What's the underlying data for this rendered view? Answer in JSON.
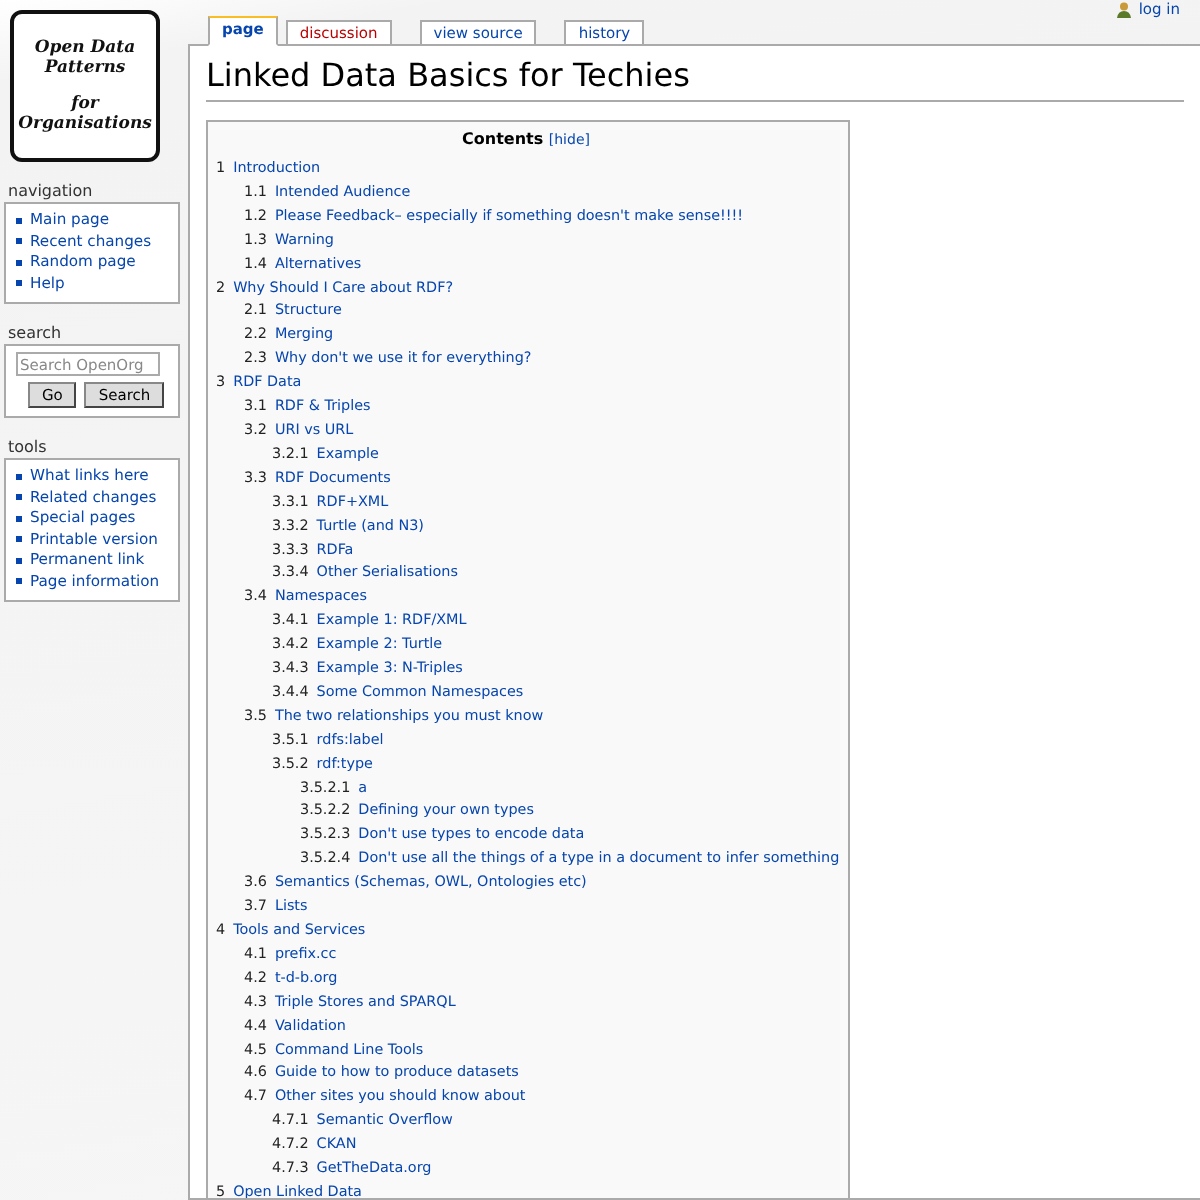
{
  "logo": {
    "lines": [
      "Open Data",
      "Patterns",
      "for",
      "Organisations"
    ]
  },
  "user_links": [
    {
      "label": "log in"
    }
  ],
  "tabs": [
    {
      "label": "page",
      "selected": true,
      "kind": "content"
    },
    {
      "label": "discussion",
      "selected": false,
      "kind": "new"
    },
    {
      "label": "view source",
      "selected": false,
      "kind": "action"
    },
    {
      "label": "history",
      "selected": false,
      "kind": "action"
    }
  ],
  "portlets": [
    {
      "kind": "links",
      "title": "navigation",
      "items": [
        "Main page",
        "Recent changes",
        "Random page",
        "Help"
      ]
    },
    {
      "kind": "search",
      "title": "search",
      "placeholder": "Search OpenOrg",
      "buttons": [
        "Go",
        "Search"
      ]
    },
    {
      "kind": "links",
      "title": "tools",
      "items": [
        "What links here",
        "Related changes",
        "Special pages",
        "Printable version",
        "Permanent link",
        "Page information"
      ]
    }
  ],
  "page_title": "Linked Data Basics for Techies",
  "toc": {
    "title": "Contents",
    "toggle": "[hide]",
    "items": [
      {
        "number": "1",
        "title": "Introduction",
        "children": [
          {
            "number": "1.1",
            "title": "Intended Audience"
          },
          {
            "number": "1.2",
            "title": "Please Feedback– especially if something doesn't make sense!!!!"
          },
          {
            "number": "1.3",
            "title": "Warning"
          },
          {
            "number": "1.4",
            "title": "Alternatives"
          }
        ]
      },
      {
        "number": "2",
        "title": "Why Should I Care about RDF?",
        "children": [
          {
            "number": "2.1",
            "title": "Structure"
          },
          {
            "number": "2.2",
            "title": "Merging"
          },
          {
            "number": "2.3",
            "title": "Why don't we use it for everything?"
          }
        ]
      },
      {
        "number": "3",
        "title": "RDF Data",
        "children": [
          {
            "number": "3.1",
            "title": "RDF & Triples"
          },
          {
            "number": "3.2",
            "title": "URI vs URL",
            "children": [
              {
                "number": "3.2.1",
                "title": "Example"
              }
            ]
          },
          {
            "number": "3.3",
            "title": "RDF Documents",
            "children": [
              {
                "number": "3.3.1",
                "title": "RDF+XML"
              },
              {
                "number": "3.3.2",
                "title": "Turtle (and N3)"
              },
              {
                "number": "3.3.3",
                "title": "RDFa"
              },
              {
                "number": "3.3.4",
                "title": "Other Serialisations"
              }
            ]
          },
          {
            "number": "3.4",
            "title": "Namespaces",
            "children": [
              {
                "number": "3.4.1",
                "title": "Example 1: RDF/XML"
              },
              {
                "number": "3.4.2",
                "title": "Example 2: Turtle"
              },
              {
                "number": "3.4.3",
                "title": "Example 3: N-Triples"
              },
              {
                "number": "3.4.4",
                "title": "Some Common Namespaces"
              }
            ]
          },
          {
            "number": "3.5",
            "title": "The two relationships you must know",
            "children": [
              {
                "number": "3.5.1",
                "title": "rdfs:label"
              },
              {
                "number": "3.5.2",
                "title": "rdf:type",
                "children": [
                  {
                    "number": "3.5.2.1",
                    "title": "a"
                  },
                  {
                    "number": "3.5.2.2",
                    "title": "Defining your own types"
                  },
                  {
                    "number": "3.5.2.3",
                    "title": "Don't use types to encode data"
                  },
                  {
                    "number": "3.5.2.4",
                    "title": "Don't use all the things of a type in a document to infer something"
                  }
                ]
              }
            ]
          },
          {
            "number": "3.6",
            "title": "Semantics (Schemas, OWL, Ontologies etc)"
          },
          {
            "number": "3.7",
            "title": "Lists"
          }
        ]
      },
      {
        "number": "4",
        "title": "Tools and Services",
        "children": [
          {
            "number": "4.1",
            "title": "prefix.cc"
          },
          {
            "number": "4.2",
            "title": "t-d-b.org"
          },
          {
            "number": "4.3",
            "title": "Triple Stores and SPARQL"
          },
          {
            "number": "4.4",
            "title": "Validation"
          },
          {
            "number": "4.5",
            "title": "Command Line Tools"
          },
          {
            "number": "4.6",
            "title": "Guide to how to produce datasets"
          },
          {
            "number": "4.7",
            "title": "Other sites you should know about",
            "children": [
              {
                "number": "4.7.1",
                "title": "Semantic Overflow"
              },
              {
                "number": "4.7.2",
                "title": "CKAN"
              },
              {
                "number": "4.7.3",
                "title": "GetTheData.org"
              }
            ]
          }
        ]
      },
      {
        "number": "5",
        "title": "Open Linked Data"
      }
    ]
  }
}
